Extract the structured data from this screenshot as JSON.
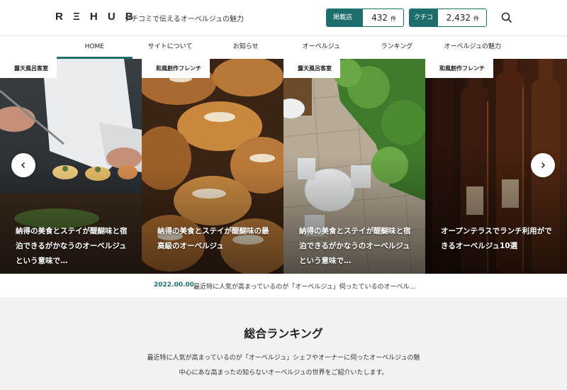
{
  "header": {
    "logo": "R Ξ H U B",
    "tagline": "クチコミで伝えるオーベルジュの魅力",
    "stats": [
      {
        "label": "掲載店舗",
        "value": "432",
        "unit": "件"
      },
      {
        "label": "クチコミ数",
        "value": "2,432",
        "unit": "件"
      }
    ],
    "search_icon": "search-icon"
  },
  "nav": {
    "items": [
      "HOME",
      "サイトについて",
      "お知らせ",
      "オーベルジュ",
      "ランキング",
      "オーベルジュの魅力"
    ],
    "active_index": 0,
    "accent_color": "#1e6e6e"
  },
  "slider": {
    "slides": [
      {
        "tag": "露天風呂客室",
        "title": "納得の美食とステイが醍醐味と宿泊できるがかなうのオーベルジュという意味で…"
      },
      {
        "tag": "和風創作フレンチ",
        "title": "納得の美食とステイが醍醐味の最高級のオーベルジュ"
      },
      {
        "tag": "露天風呂客室",
        "title": "納得の美食とステイが醍醐味と宿泊できるがかなうのオーベルジュという意味で…"
      },
      {
        "tag": "和風創作フレンチ",
        "title": "オープンテラスでランチ利用ができるオーベルジュ10選"
      }
    ],
    "prev_icon": "chevron-left-icon",
    "next_icon": "chevron-right-icon"
  },
  "news": {
    "date": "2022.00.00",
    "text": "最近特に人気が高まっているのが「オーベルジュ」伺ったているのオーベル…"
  },
  "ranking": {
    "title": "総合ランキング",
    "desc_line1": "最近特に人気が高まっているのが「オーベルジュ」シェフやオーナーに伺ったオーベルジュの魅",
    "desc_line2": "中心にあな高まったの知らないオーベルジュの世界をご紹介いたします。"
  }
}
